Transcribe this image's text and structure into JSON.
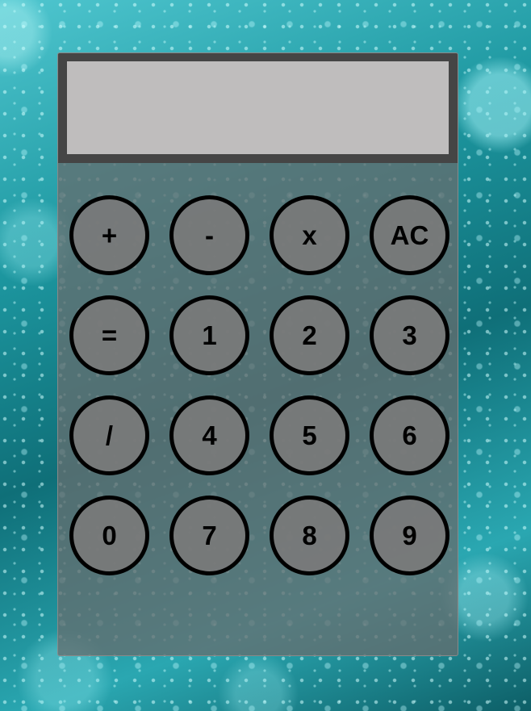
{
  "display": {
    "value": ""
  },
  "keypad": {
    "keys": [
      {
        "label": "+",
        "name": "plus-button"
      },
      {
        "label": "-",
        "name": "minus-button"
      },
      {
        "label": "x",
        "name": "multiply-button"
      },
      {
        "label": "AC",
        "name": "all-clear-button"
      },
      {
        "label": "=",
        "name": "equals-button"
      },
      {
        "label": "1",
        "name": "digit-1-button"
      },
      {
        "label": "2",
        "name": "digit-2-button"
      },
      {
        "label": "3",
        "name": "digit-3-button"
      },
      {
        "label": "/",
        "name": "divide-button"
      },
      {
        "label": "4",
        "name": "digit-4-button"
      },
      {
        "label": "5",
        "name": "digit-5-button"
      },
      {
        "label": "6",
        "name": "digit-6-button"
      },
      {
        "label": "0",
        "name": "digit-0-button"
      },
      {
        "label": "7",
        "name": "digit-7-button"
      },
      {
        "label": "8",
        "name": "digit-8-button"
      },
      {
        "label": "9",
        "name": "digit-9-button"
      }
    ]
  }
}
